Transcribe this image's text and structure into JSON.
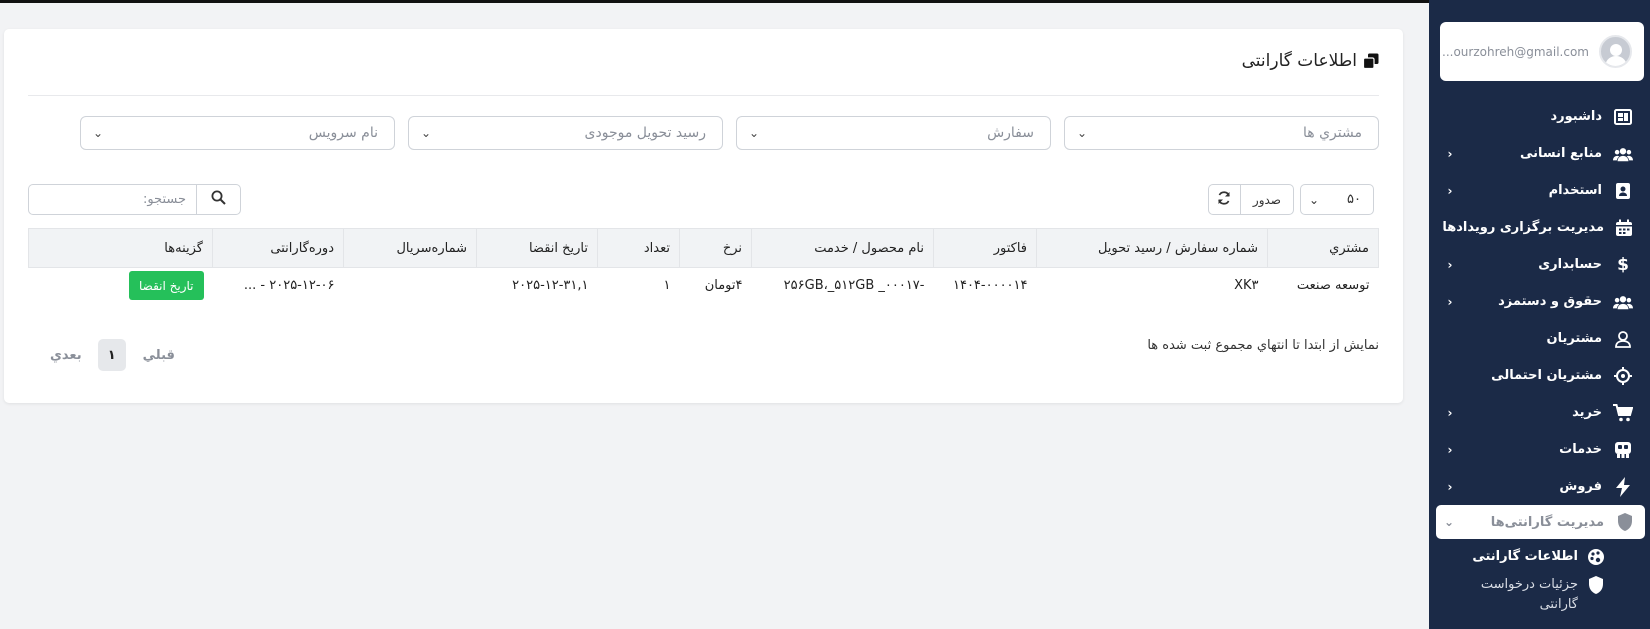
{
  "user": {
    "email": "...ourzohreh@gmail.com"
  },
  "sidebar": {
    "items": [
      {
        "label": "داشبورد",
        "icon": "dashboard-icon",
        "has_children": false
      },
      {
        "label": "منابع انسانی",
        "icon": "users-icon",
        "has_children": true
      },
      {
        "label": "استخدام",
        "icon": "id-card-icon",
        "has_children": true
      },
      {
        "label": "مدیریت برگزاری رویدادها",
        "icon": "calendar-icon",
        "has_children": false
      },
      {
        "label": "حسابداری",
        "icon": "dollar-icon",
        "has_children": true
      },
      {
        "label": "حقوق و دستمزد",
        "icon": "users-icon",
        "has_children": true
      },
      {
        "label": "مشتریان",
        "icon": "user-icon",
        "has_children": false
      },
      {
        "label": "مشتریان احتمالی",
        "icon": "crosshair-icon",
        "has_children": false
      },
      {
        "label": "خرید",
        "icon": "cart-icon",
        "has_children": true
      },
      {
        "label": "خدمات",
        "icon": "services-icon",
        "has_children": true
      },
      {
        "label": "فروش",
        "icon": "bolt-icon",
        "has_children": true
      },
      {
        "label": "مدیریت گارانتی‌ها",
        "icon": "shield-icon",
        "has_children": true,
        "active": true
      }
    ],
    "sub_items": [
      {
        "label": "اطلاعات گارانتی",
        "icon": "palette-icon"
      },
      {
        "label": "جزئیات درخواست گارانتی",
        "icon": "shield-icon"
      }
    ]
  },
  "page": {
    "title": "اطلاعات گارانتی"
  },
  "filters": {
    "customers": "مشتري ها",
    "order": "سفارش",
    "inventory_receipt": "رسید تحویل موجودی",
    "service_name": "نام سرويس"
  },
  "toolbar": {
    "page_size": "۵۰",
    "export_label": "صدور",
    "search_placeholder": "جستجو:"
  },
  "table": {
    "headers": [
      "مشتري",
      "شماره سفارش / رسید تحویل",
      "فاکتور",
      "نام محصول / خدمت",
      "نرخ",
      "تعداد",
      "تاریخ انقضا",
      "شماره‌سریال",
      "دوره‌گارانتی",
      "گزینه‌ها"
    ],
    "rows": [
      {
        "customer": "توسعه صنعت",
        "order": "XK۳",
        "invoice": "۱۴۰۴-۰۰۰۰۱۴",
        "product": "-۲۵۶GB،_۵۱۲GB _۰۰۰۱۷",
        "rate": "۴تومان",
        "quantity": "۱",
        "expiry": "۲۰۲۵-۱۲-۳۱,۱",
        "serial": "",
        "warranty_period": "۲۰۲۵-۱۲-۰۶ - ...",
        "action_label": "تاریخ انقضا"
      }
    ]
  },
  "footer": {
    "info": "نمایش از ابتدا تا انتهاي مجموع ثبت شده ها",
    "prev_label": "قبلي",
    "current_page": "۱",
    "next_label": "بعدي"
  },
  "colors": {
    "sidebar_bg": "#1b2a47",
    "action_button": "#25c05a",
    "table_header_bg": "#f1f3f5"
  }
}
